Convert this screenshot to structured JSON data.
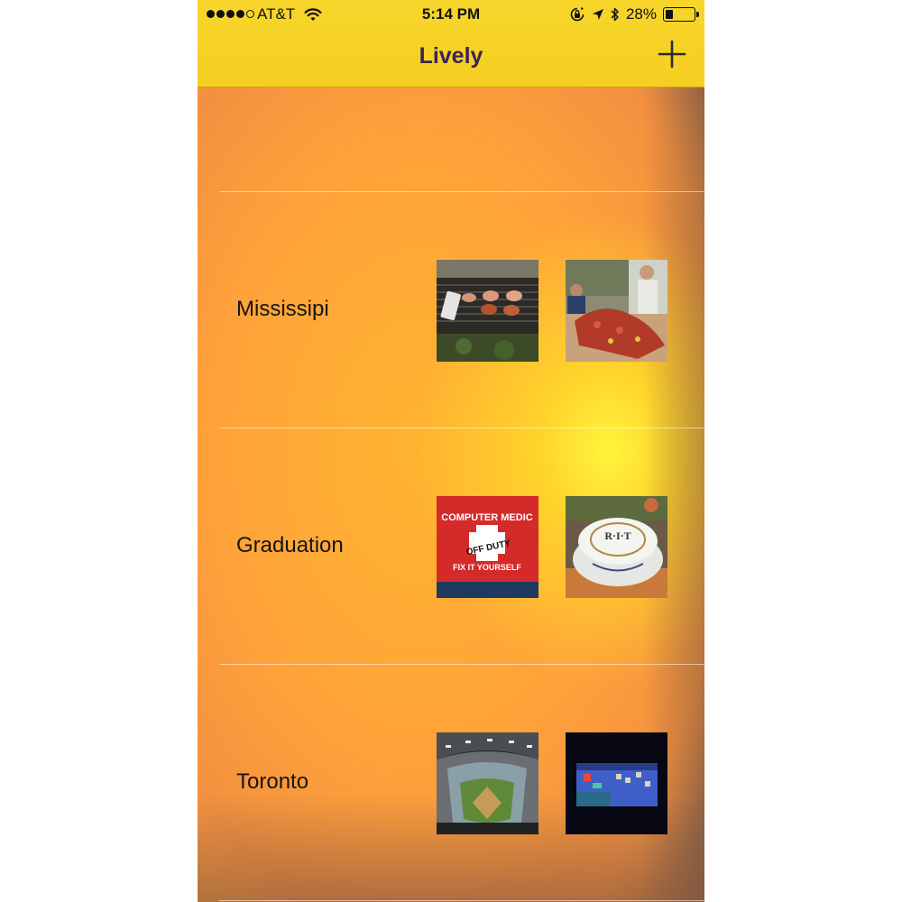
{
  "status_bar": {
    "carrier": "AT&T",
    "time": "5:14 PM",
    "battery": "28%",
    "signal_bars_filled": 4,
    "signal_bars_total": 5
  },
  "nav": {
    "title": "Lively",
    "add_icon": "plus-icon"
  },
  "albums": [
    {
      "label": "Mississipi",
      "photos": [
        "grill-photo",
        "crawfish-boil-photo"
      ]
    },
    {
      "label": "Graduation",
      "photos": [
        "computer-medic-shirt-photo",
        "rit-cake-photo"
      ]
    },
    {
      "label": "Toronto",
      "photos": [
        "stadium-photo",
        "scoreboard-screen-photo"
      ]
    }
  ],
  "colors": {
    "nav_bar": "#f5d024",
    "title": "#3b2352",
    "background_warm": "#ffa53a",
    "background_glow": "#fff23c"
  },
  "photo_text": {
    "shirt_line1": "COMPUTER MEDIC",
    "shirt_line2": "OFF DUTY",
    "shirt_line3": "FIX IT YOURSELF",
    "cake_text": "R·I·T"
  }
}
